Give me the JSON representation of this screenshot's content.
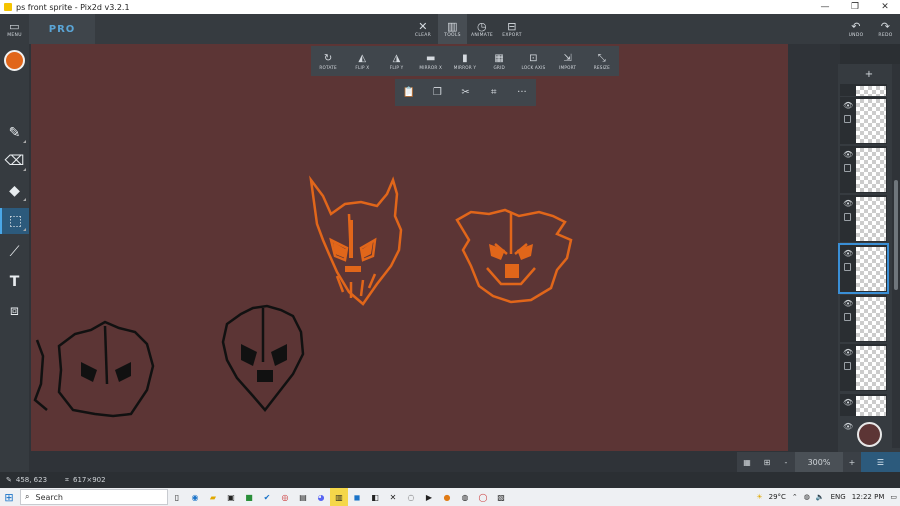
{
  "window": {
    "title": "ps front sprite - Pix2d v3.2.1",
    "min": "—",
    "max": "❐",
    "close": "✕"
  },
  "topbar": {
    "menu_label": "MENU",
    "pro_label": "PRO",
    "clear_label": "CLEAR",
    "tools_label": "TOOLS",
    "animate_label": "ANIMATE",
    "export_label": "EXPORT",
    "undo_label": "UNDO",
    "redo_label": "REDO"
  },
  "tools_panel": {
    "items": [
      "ROTATE",
      "FLIP X",
      "FLIP Y",
      "MIRROR X",
      "MIRROR Y",
      "GRID",
      "LOCK AXIS",
      "IMPORT",
      "RESIZE"
    ]
  },
  "clip_panel": {
    "more": "···"
  },
  "layers_panel": {
    "add": "+"
  },
  "zoom": {
    "minus": "-",
    "value": "300%",
    "plus": "+"
  },
  "status": {
    "cursor": "458, 623",
    "selection": "617×902"
  },
  "taskbar": {
    "search_placeholder": "Search",
    "weather": "29°C",
    "language": "ENG",
    "time": "12:22 PM"
  },
  "colors": {
    "primary": "#e1661a",
    "canvas_bg": "#5c3535",
    "accent": "#3a8fd6"
  }
}
